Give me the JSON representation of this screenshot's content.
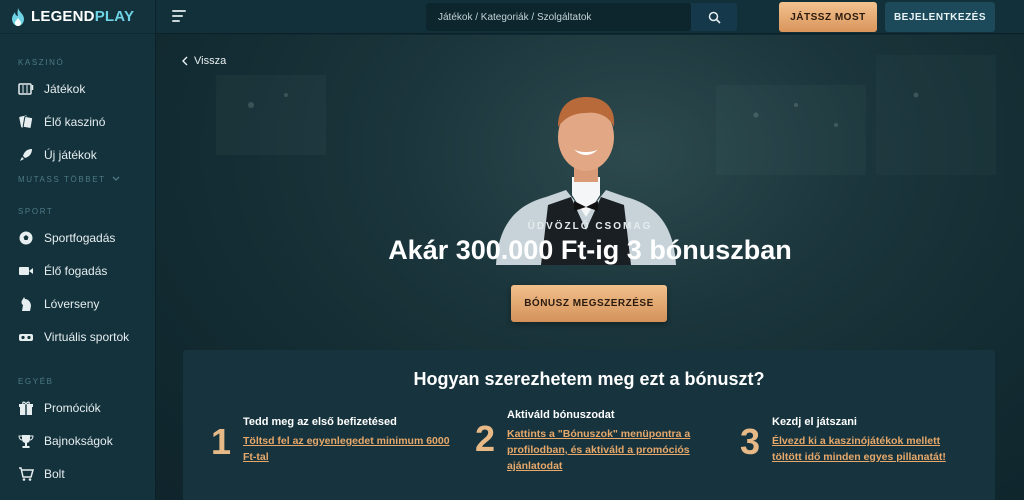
{
  "brand": {
    "part1": "LEGEND",
    "part2": "PLAY"
  },
  "sidebar": {
    "sections": [
      {
        "title": "KASZINÓ",
        "items": [
          {
            "label": "Játékok",
            "icon": "slot-machine-icon"
          },
          {
            "label": "Élő kaszinó",
            "icon": "cards-icon"
          },
          {
            "label": "Új játékok",
            "icon": "rocket-icon"
          }
        ],
        "more": "MUTASS TÖBBET"
      },
      {
        "title": "SPORT",
        "items": [
          {
            "label": "Sportfogadás",
            "icon": "soccer-ball-icon"
          },
          {
            "label": "Élő fogadás",
            "icon": "video-camera-icon"
          },
          {
            "label": "Lóverseny",
            "icon": "horse-icon"
          },
          {
            "label": "Virtuális sportok",
            "icon": "vr-headset-icon"
          }
        ]
      },
      {
        "title": "EGYÉB",
        "items": [
          {
            "label": "Promóciók",
            "icon": "gift-icon"
          },
          {
            "label": "Bajnokságok",
            "icon": "trophy-icon"
          },
          {
            "label": "Bolt",
            "icon": "shopping-cart-icon"
          }
        ]
      }
    ]
  },
  "topbar": {
    "search_placeholder": "Játékok / Kategoriák / Szolgáltatok",
    "play_label": "JÁTSSZ MOST",
    "login_label": "BEJELENTKEZÉS"
  },
  "hero": {
    "back_label": "Vissza",
    "welcome": "ÜDVÖZLŐ CSOMAG",
    "headline": "Akár 300.000 Ft-ig 3 bónuszban",
    "cta": "BÓNUSZ MEGSZERZÉSE"
  },
  "howto": {
    "title": "Hogyan szerezhetem meg ezt a bónuszt?",
    "steps": [
      {
        "num": "1",
        "title": "Tedd meg az első befizetésed",
        "desc": "Töltsd fel az egyenlegedet minimum 6000 Ft-tal"
      },
      {
        "num": "2",
        "title": "Aktiváld bónuszodat",
        "desc": "Kattints a \"Bónuszok\" menüpontra a profilodban, és aktiváld a promóciós ajánlatodat"
      },
      {
        "num": "3",
        "title": "Kezdj el játszani",
        "desc": "Élvezd ki a kaszinójátékok mellett töltött idő minden egyes pillanatát!"
      }
    ]
  },
  "colors": {
    "accent": "#e7a86a",
    "sidebar_bg": "#13323c",
    "button_gold": "#e8b07a"
  }
}
